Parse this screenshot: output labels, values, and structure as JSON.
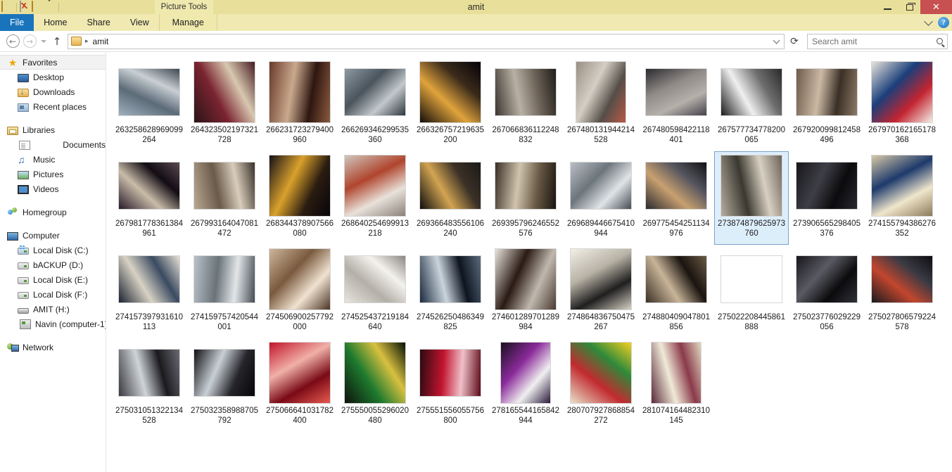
{
  "window": {
    "title": "amit",
    "contextual_tools": "Picture Tools",
    "controls": {
      "minimize": "Minimize",
      "maximize": "Maximize",
      "close": "Close"
    },
    "quick_access": [
      "explorer-icon",
      "properties-icon",
      "new-folder-icon",
      "customize-qat-dropdown"
    ]
  },
  "ribbon": {
    "tabs": [
      {
        "label": "File",
        "id": "file"
      },
      {
        "label": "Home",
        "id": "home"
      },
      {
        "label": "Share",
        "id": "share"
      },
      {
        "label": "View",
        "id": "view"
      },
      {
        "label": "Manage",
        "id": "manage"
      }
    ],
    "expand_label": "Expand the Ribbon",
    "help_label": "?"
  },
  "address": {
    "back": "Back",
    "forward": "Forward",
    "recent_dropdown": "Recent locations",
    "up": "Up",
    "crumb_root_icon": "folder-icon",
    "crumb": "amit",
    "history_dropdown": "Previous locations",
    "refresh": "Refresh"
  },
  "search": {
    "placeholder": "Search amit",
    "value": ""
  },
  "sidebar": {
    "groups": [
      {
        "header": {
          "label": "Favorites",
          "icon": "star-icon",
          "selected": true
        },
        "items": [
          {
            "label": "Desktop",
            "icon": "desktop-icon"
          },
          {
            "label": "Downloads",
            "icon": "downloads-folder-icon"
          },
          {
            "label": "Recent places",
            "icon": "recent-places-icon"
          }
        ]
      },
      {
        "header": {
          "label": "Libraries",
          "icon": "libraries-icon",
          "selected": false
        },
        "items": [
          {
            "label": "Documents",
            "icon": "document-icon"
          },
          {
            "label": "Music",
            "icon": "music-note-icon"
          },
          {
            "label": "Pictures",
            "icon": "picture-icon"
          },
          {
            "label": "Videos",
            "icon": "video-icon"
          }
        ]
      },
      {
        "header": {
          "label": "Homegroup",
          "icon": "homegroup-icon",
          "selected": false
        },
        "items": []
      },
      {
        "header": {
          "label": "Computer",
          "icon": "computer-icon",
          "selected": false
        },
        "items": [
          {
            "label": "Local Disk (C:)",
            "icon": "system-drive-icon"
          },
          {
            "label": "bACKUP (D:)",
            "icon": "drive-icon"
          },
          {
            "label": "Local Disk (E:)",
            "icon": "drive-icon"
          },
          {
            "label": "Local Disk (F:)",
            "icon": "drive-icon"
          },
          {
            "label": "AMIT (H:)",
            "icon": "usb-drive-icon"
          },
          {
            "label": "Navin (computer-1)",
            "icon": "remote-computer-icon"
          }
        ]
      },
      {
        "header": {
          "label": "Network",
          "icon": "network-icon",
          "selected": false
        },
        "items": []
      }
    ]
  },
  "colors": {
    "title_bar": "#e8e09a",
    "ribbon": "#f0eab2",
    "file_tab": "#1a74bc",
    "close_button": "#c75050",
    "selection_fill": "#ddeefb",
    "selection_border": "#7da2ce"
  },
  "files": [
    {
      "name": "263258628969099264",
      "selected": false,
      "shape": "wide",
      "colors": [
        "#9fb0bd",
        "#5c6b78",
        "#c9cfd4",
        "#3d4750"
      ]
    },
    {
      "name": "264323502197321728",
      "selected": false,
      "shape": "square",
      "colors": [
        "#2b1418",
        "#7a2430",
        "#d8c8b0",
        "#451a20"
      ]
    },
    {
      "name": "266231723279400960",
      "selected": false,
      "shape": "square",
      "colors": [
        "#6b3a2a",
        "#c9a98d",
        "#2e1610",
        "#8a5a3e"
      ]
    },
    {
      "name": "266269346299535360",
      "selected": false,
      "shape": "wide",
      "colors": [
        "#8d9aa3",
        "#4a545c",
        "#c2c8cc",
        "#2f373d"
      ]
    },
    {
      "name": "266326757219635200",
      "selected": false,
      "shape": "square",
      "colors": [
        "#120d0a",
        "#e0a33c",
        "#3a2a1a",
        "#06030a"
      ]
    },
    {
      "name": "267066836112248832",
      "selected": false,
      "shape": "wide",
      "colors": [
        "#3b3530",
        "#b9b0a4",
        "#6c6258",
        "#201c18"
      ]
    },
    {
      "name": "267480131944214528",
      "selected": false,
      "shape": "tall",
      "colors": [
        "#9a8e84",
        "#d4cec4",
        "#554e48",
        "#b85a46"
      ]
    },
    {
      "name": "267480598422118401",
      "selected": false,
      "shape": "wide",
      "colors": [
        "#2b2a30",
        "#8f8a86",
        "#b5b0aa",
        "#45424a"
      ]
    },
    {
      "name": "267577734778200065",
      "selected": false,
      "shape": "wide",
      "colors": [
        "#1b1b1b",
        "#f0f0f0",
        "#6e6e6e",
        "#2a2a2a"
      ]
    },
    {
      "name": "267920099812458496",
      "selected": false,
      "shape": "wide",
      "colors": [
        "#6e5c4c",
        "#cbb9a4",
        "#3a2f26",
        "#8d7a66"
      ]
    },
    {
      "name": "267970162165178368",
      "selected": false,
      "shape": "square",
      "colors": [
        "#e8e4dc",
        "#1b3f7a",
        "#c32430",
        "#f2efe8"
      ]
    },
    {
      "name": "267981778361384961",
      "selected": false,
      "shape": "wide",
      "colors": [
        "#271a2a",
        "#c9bca8",
        "#120c14",
        "#5a4a50"
      ]
    },
    {
      "name": "267993164047081472",
      "selected": false,
      "shape": "wide",
      "colors": [
        "#b9a892",
        "#6a5a4a",
        "#d8cdbb",
        "#3a3028"
      ]
    },
    {
      "name": "268344378907566080",
      "selected": false,
      "shape": "square",
      "colors": [
        "#151018",
        "#d9a12c",
        "#2a1c10",
        "#070409"
      ]
    },
    {
      "name": "268640254699913218",
      "selected": false,
      "shape": "square",
      "colors": [
        "#cfc6bc",
        "#b0452e",
        "#e8e2da",
        "#8a8078"
      ]
    },
    {
      "name": "269366483556106240",
      "selected": false,
      "shape": "wide",
      "colors": [
        "#0d0d0d",
        "#d2a452",
        "#3a3026",
        "#1c1a18"
      ]
    },
    {
      "name": "269395796246552576",
      "selected": false,
      "shape": "wide",
      "colors": [
        "#3a2f26",
        "#d0c4ae",
        "#6a5a46",
        "#1a140f"
      ]
    },
    {
      "name": "269689446675410944",
      "selected": false,
      "shape": "wide",
      "colors": [
        "#b9bec4",
        "#6d757c",
        "#e0e4e7",
        "#444b52"
      ]
    },
    {
      "name": "269775454251134976",
      "selected": false,
      "shape": "wide",
      "colors": [
        "#2a2a30",
        "#c8a070",
        "#55555e",
        "#111114"
      ]
    },
    {
      "name": "273874879625973760",
      "selected": true,
      "shape": "square",
      "colors": [
        "#b6ada0",
        "#3b3830",
        "#d8d0c2",
        "#6a6258"
      ]
    },
    {
      "name": "273906565298405376",
      "selected": false,
      "shape": "wide",
      "colors": [
        "#16161a",
        "#3e3e46",
        "#0b0b0d",
        "#282830"
      ]
    },
    {
      "name": "274155794386276352",
      "selected": false,
      "shape": "square",
      "colors": [
        "#d8c9a8",
        "#1d3a6b",
        "#f0e6cc",
        "#8a7a58"
      ]
    },
    {
      "name": "274157397931610113",
      "selected": false,
      "shape": "wide",
      "colors": [
        "#1a2230",
        "#d8d2c4",
        "#3a4a60",
        "#e8e2d6"
      ]
    },
    {
      "name": "274159757420544001",
      "selected": false,
      "shape": "wide",
      "colors": [
        "#b9c2c8",
        "#6a737a",
        "#e2e6e9",
        "#444c52"
      ]
    },
    {
      "name": "274506900257792000",
      "selected": false,
      "shape": "square",
      "colors": [
        "#cdb69a",
        "#7a5a3e",
        "#f0e2d0",
        "#4a3424"
      ]
    },
    {
      "name": "274525437219184640",
      "selected": false,
      "shape": "wide",
      "colors": [
        "#e6e4de",
        "#b4b0a8",
        "#f4f2ee",
        "#8a8680"
      ]
    },
    {
      "name": "274526250486349825",
      "selected": false,
      "shape": "wide",
      "colors": [
        "#1b2a3e",
        "#c9d4dc",
        "#0d1420",
        "#5a6a7a"
      ]
    },
    {
      "name": "274601289701289984",
      "selected": false,
      "shape": "square",
      "colors": [
        "#e8e4dc",
        "#2a1a14",
        "#c0b8ae",
        "#4a3a30"
      ]
    },
    {
      "name": "274864836750475267",
      "selected": false,
      "shape": "square",
      "colors": [
        "#f2efe6",
        "#b8b2a6",
        "#1f1f1f",
        "#d8d2c6"
      ]
    },
    {
      "name": "274880409047801856",
      "selected": false,
      "shape": "wide",
      "colors": [
        "#3a3026",
        "#c8b498",
        "#1a1410",
        "#6a5a46"
      ]
    },
    {
      "name": "275022208445861888",
      "selected": false,
      "shape": "wide",
      "colors": [
        "#d2cdc4",
        "#7a7469",
        "#ecе8e0",
        "#4a443c"
      ]
    },
    {
      "name": "275023776029229056",
      "selected": false,
      "shape": "wide",
      "colors": [
        "#16161a",
        "#5a5a64",
        "#0b0b0d",
        "#30303a"
      ]
    },
    {
      "name": "275027806579224578",
      "selected": false,
      "shape": "wide",
      "colors": [
        "#1a1a1e",
        "#c2462e",
        "#3a3a44",
        "#0d0d10"
      ]
    },
    {
      "name": "275031051322134528",
      "selected": false,
      "shape": "wide",
      "colors": [
        "#3a3a40",
        "#cfd4d8",
        "#1a1a1e",
        "#6a6a74"
      ]
    },
    {
      "name": "275032358988705792",
      "selected": false,
      "shape": "wide",
      "colors": [
        "#0f0f12",
        "#c8d0d6",
        "#25252a",
        "#060608"
      ]
    },
    {
      "name": "275066641031782400",
      "selected": false,
      "shape": "square",
      "colors": [
        "#c2142a",
        "#f0b0a8",
        "#7a0a16",
        "#e85a50"
      ]
    },
    {
      "name": "275550055296020480",
      "selected": false,
      "shape": "square",
      "colors": [
        "#0d120d",
        "#1e7a2e",
        "#d8c040",
        "#051005"
      ]
    },
    {
      "name": "275551556055756800",
      "selected": false,
      "shape": "wide",
      "colors": [
        "#2a0a10",
        "#c21430",
        "#f0c0c8",
        "#5a0a18"
      ]
    },
    {
      "name": "278165544165842944",
      "selected": false,
      "shape": "tall",
      "colors": [
        "#1a1020",
        "#8a2a9a",
        "#f0f0f0",
        "#2a1a3a"
      ]
    },
    {
      "name": "280707927868854272",
      "selected": false,
      "shape": "square",
      "colors": [
        "#e8e0c8",
        "#c22a30",
        "#2e8a3a",
        "#f4d020"
      ]
    },
    {
      "name": "281074164482310145",
      "selected": false,
      "shape": "tall",
      "colors": [
        "#5a2a3a",
        "#f0ead8",
        "#8a3a4a",
        "#e0d8c0"
      ]
    }
  ]
}
